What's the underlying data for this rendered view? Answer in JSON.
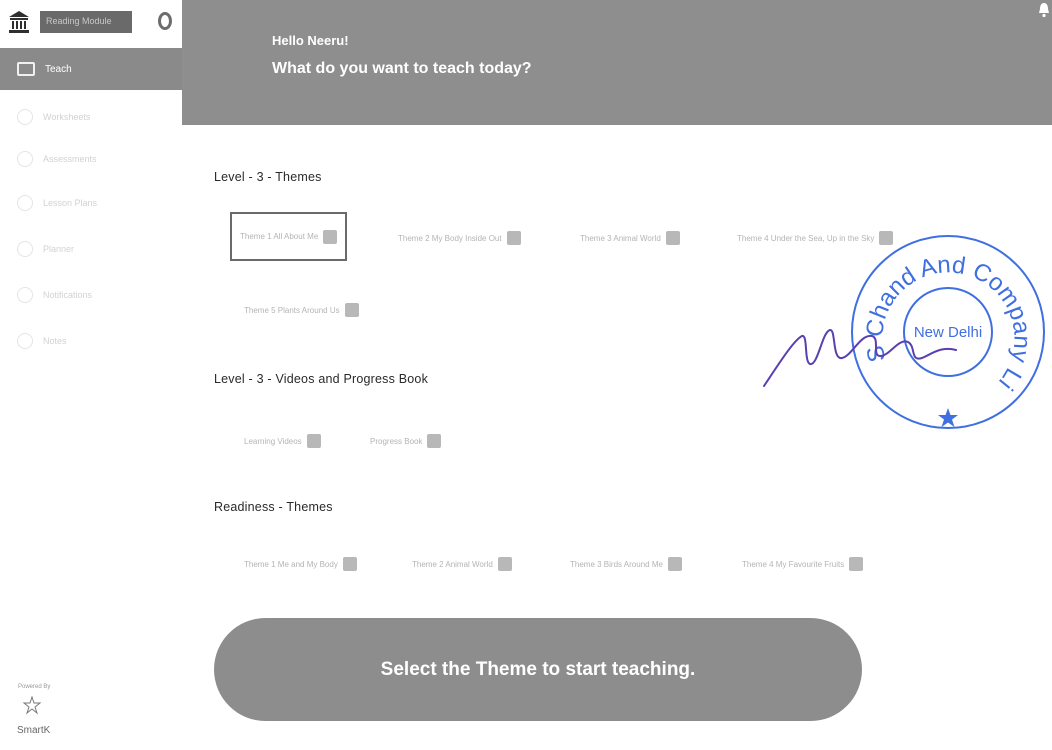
{
  "sidebar": {
    "app_name": "Reading Module",
    "items": [
      {
        "label": "Teach"
      },
      {
        "label": "Worksheets"
      },
      {
        "label": "Assessments"
      },
      {
        "label": "Lesson Plans"
      },
      {
        "label": "Planner"
      },
      {
        "label": "Notifications"
      },
      {
        "label": "Notes"
      }
    ],
    "powered_by": "Powered By",
    "brand": "SmartK"
  },
  "header": {
    "greeting": "Hello Neeru!",
    "question": "What do you want to teach today?"
  },
  "sections": [
    {
      "title": "Level - 3 - Themes",
      "items": [
        {
          "label": "Theme 1 All About Me"
        },
        {
          "label": "Theme 2 My Body Inside Out"
        },
        {
          "label": "Theme 3 Animal World"
        },
        {
          "label": "Theme 4 Under the Sea, Up in the Sky"
        },
        {
          "label": "Theme 5 Plants Around Us"
        }
      ]
    },
    {
      "title": "Level - 3 - Videos and Progress Book",
      "items": [
        {
          "label": "Learning Videos"
        },
        {
          "label": "Progress Book"
        }
      ]
    },
    {
      "title": "Readiness - Themes",
      "items": [
        {
          "label": "Theme 1 Me and My Body"
        },
        {
          "label": "Theme 2 Animal World"
        },
        {
          "label": "Theme 3 Birds Around Me"
        },
        {
          "label": "Theme 4 My Favourite Fruits"
        }
      ]
    }
  ],
  "cta": "Select the Theme to start teaching.",
  "stamp": {
    "text": "S Chand And Company Limited",
    "center": "New Delhi",
    "color": "#3f6fe0"
  },
  "colors": {
    "banner": "#8e8e8e",
    "active_item": "#8a8a8a",
    "pill": "#8d8d8d"
  }
}
